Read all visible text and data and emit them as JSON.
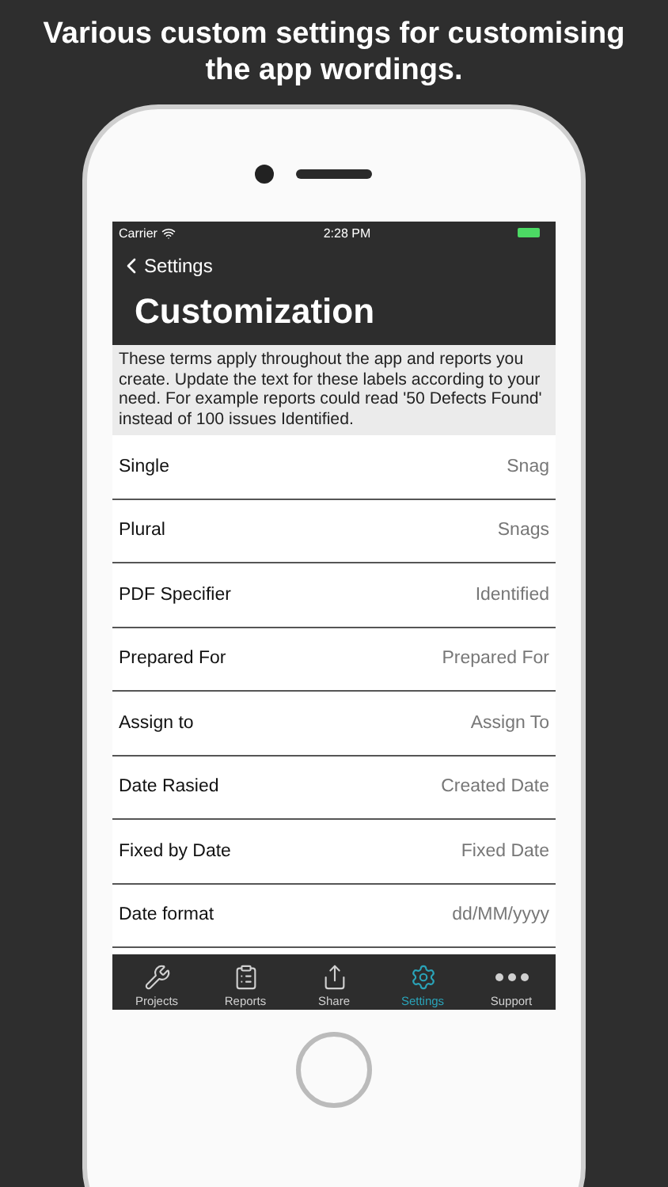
{
  "headline": "Various custom settings for customising the app wordings.",
  "status_bar": {
    "carrier": "Carrier",
    "time": "2:28 PM"
  },
  "nav": {
    "back": "Settings",
    "title": "Customization"
  },
  "description": "These terms apply throughout the app and reports you create. Update the text for these labels according to your need. For example reports could read '50 Defects Found' instead of 100 issues Identified.",
  "rows": [
    {
      "label": "Single",
      "value": "Snag"
    },
    {
      "label": "Plural",
      "value": "Snags"
    },
    {
      "label": "PDF Specifier",
      "value": "Identified"
    },
    {
      "label": "Prepared For",
      "value": "Prepared For"
    },
    {
      "label": "Assign to",
      "value": "Assign To"
    },
    {
      "label": "Date Rasied",
      "value": "Created Date"
    },
    {
      "label": "Fixed by Date",
      "value": "Fixed Date"
    },
    {
      "label": "Date format",
      "value": "dd/MM/yyyy"
    }
  ],
  "tabs": [
    {
      "label": "Projects",
      "selected": false
    },
    {
      "label": "Reports",
      "selected": false
    },
    {
      "label": "Share",
      "selected": false
    },
    {
      "label": "Settings",
      "selected": true
    },
    {
      "label": "Support",
      "selected": false
    }
  ]
}
